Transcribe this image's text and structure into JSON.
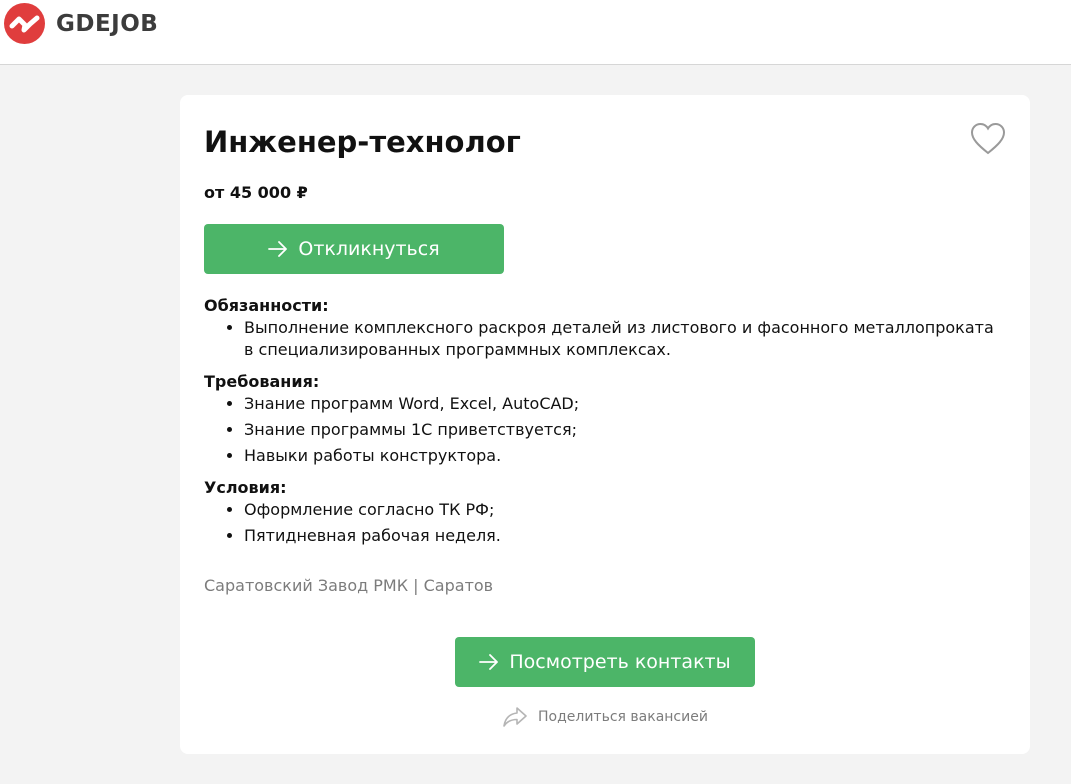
{
  "header": {
    "logo_text": "GDEJOB",
    "logo_color": "#e03d3d"
  },
  "vacancy": {
    "title": "Инженер-технолог",
    "salary": "от 45 000 ₽",
    "apply_label": "Откликнуться",
    "sections": [
      {
        "title": "Обязанности:",
        "items": [
          "Выполнение комплексного раскроя деталей из листового и фасонного металлопроката в специализированных программных комплексах."
        ]
      },
      {
        "title": "Требования:",
        "items": [
          "Знание программ Word, Excel, AutoCAD;",
          "Знание программы 1С приветствуется;",
          "Навыки работы конструктора."
        ]
      },
      {
        "title": "Условия:",
        "items": [
          "Оформление согласно ТК РФ;",
          "Пятидневная рабочая неделя."
        ]
      }
    ],
    "company": "Саратовский Завод РМК | Саратов",
    "contacts_label": "Посмотреть контакты",
    "share_label": "Поделиться вакансией"
  },
  "icons": {
    "logo": "logo-icon",
    "favorite": "heart-icon",
    "apply_arrow": "arrow-right-icon",
    "contacts_arrow": "arrow-right-icon",
    "share": "share-icon"
  },
  "colors": {
    "accent_green": "#4cb568",
    "muted_text": "#7c7c7c",
    "page_bg": "#f3f3f3"
  }
}
